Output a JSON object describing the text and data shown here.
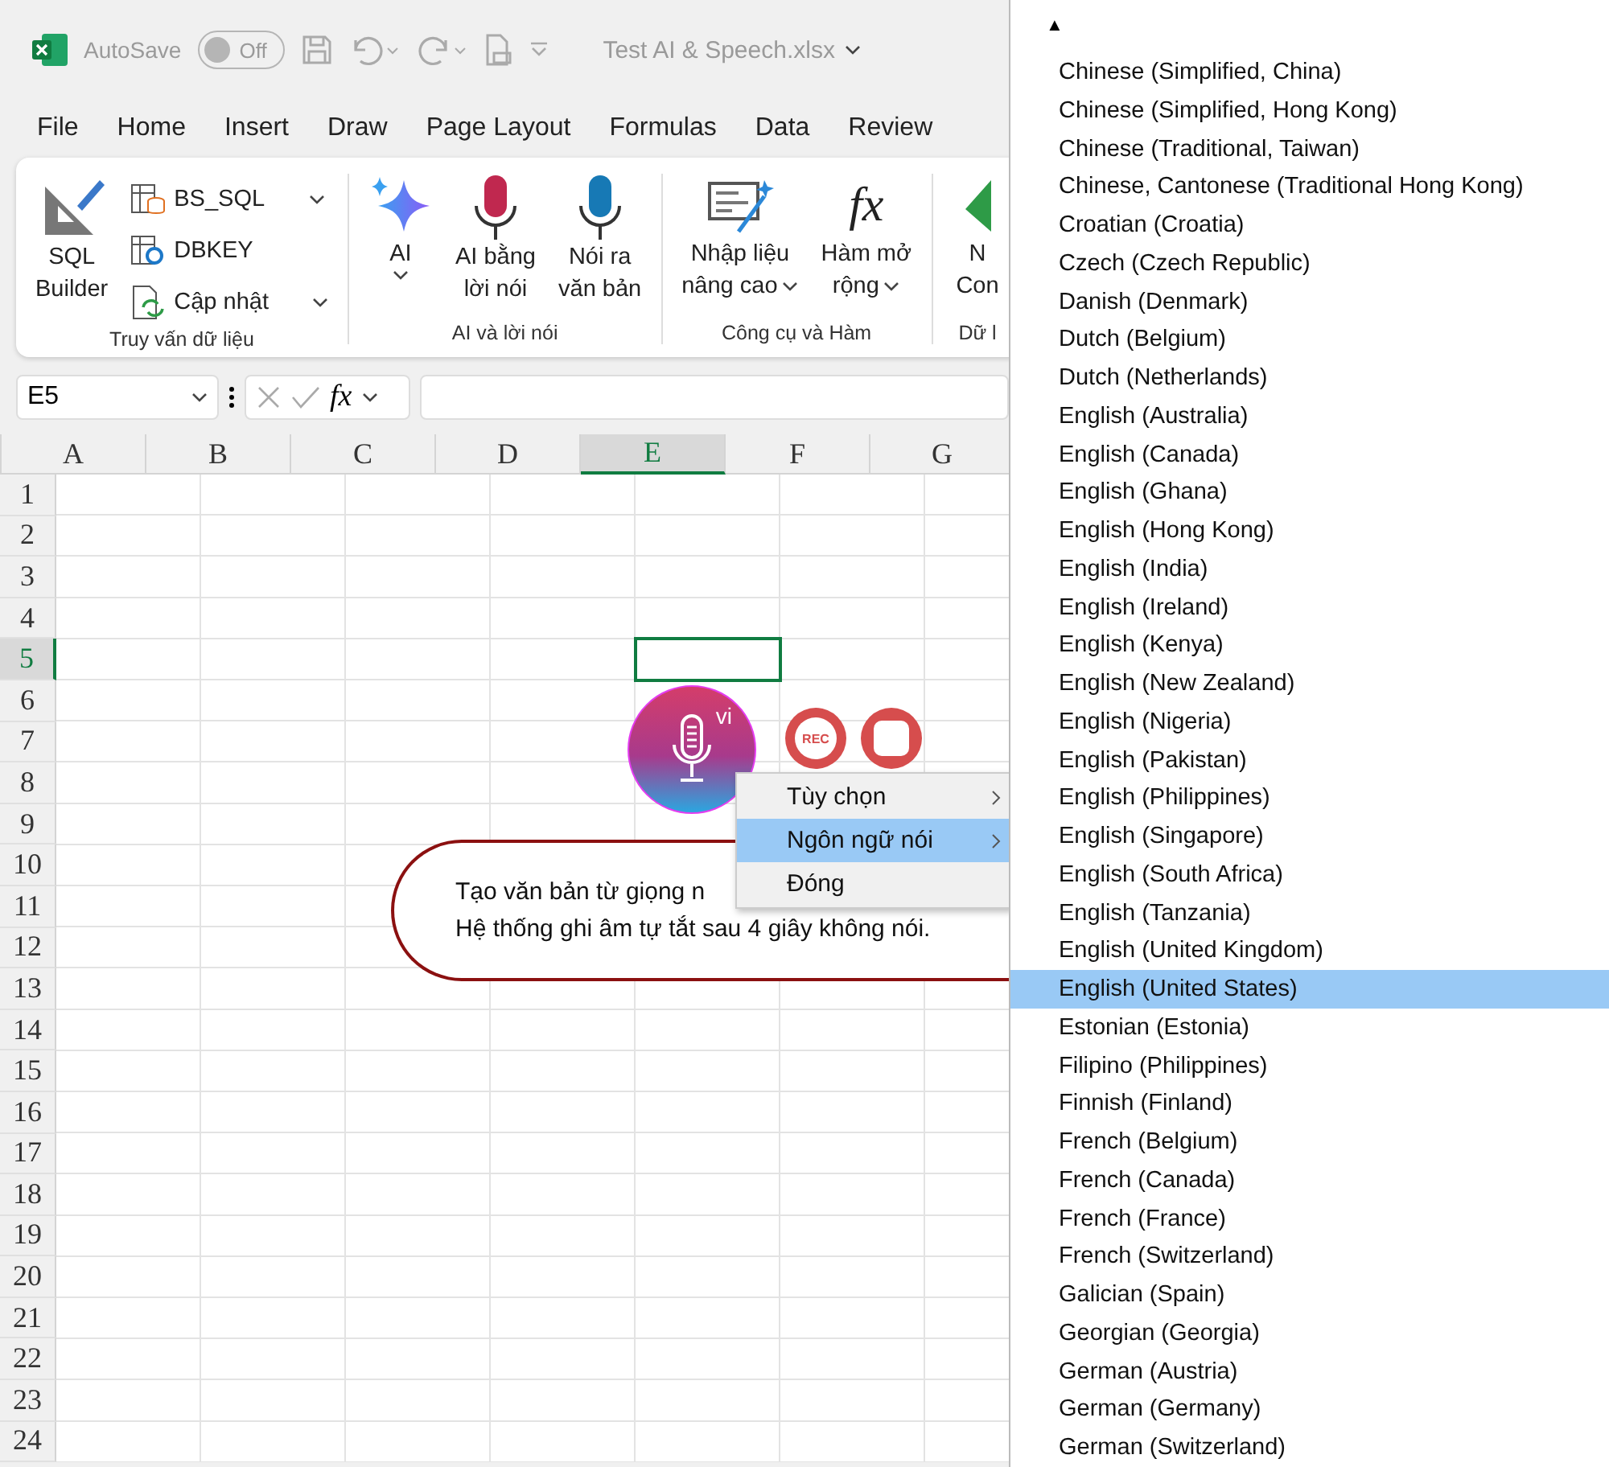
{
  "title_bar": {
    "autosave_label": "AutoSave",
    "autosave_toggle": {
      "label": "Off",
      "on": false
    },
    "file_title": "Test AI & Speech.xlsx"
  },
  "menu_tabs": [
    "File",
    "Home",
    "Insert",
    "Draw",
    "Page Layout",
    "Formulas",
    "Data",
    "Review"
  ],
  "ribbon": {
    "groups": [
      {
        "label": "Truy vấn dữ liệu",
        "large": [
          {
            "kind": "sql",
            "lines": [
              "SQL",
              "Builder"
            ],
            "caret": false
          }
        ],
        "small": [
          {
            "kind": "table-db",
            "label": "BS_SQL",
            "caret": true
          },
          {
            "kind": "table-gear",
            "label": "DBKEY",
            "caret": false
          },
          {
            "kind": "refresh",
            "label": "Cập nhật",
            "caret": true
          }
        ]
      },
      {
        "label": "AI và lời nói",
        "large": [
          {
            "kind": "sparkle",
            "lines": [
              "AI"
            ],
            "caret": true
          },
          {
            "kind": "mic-red",
            "lines": [
              "AI bằng",
              "lời nói"
            ],
            "caret": false
          },
          {
            "kind": "mic-blue",
            "lines": [
              "Nói ra",
              "văn bản"
            ],
            "caret": false
          }
        ]
      },
      {
        "label": "Công cụ và Hàm",
        "large": [
          {
            "kind": "form",
            "lines": [
              "Nhập liệu",
              "nâng cao"
            ],
            "caret": true
          },
          {
            "kind": "fx",
            "glyph": "fx",
            "lines": [
              "Hàm mở",
              "rộng"
            ],
            "caret": true
          }
        ]
      },
      {
        "label": "Dữ l",
        "large": [
          {
            "kind": "shape",
            "lines": [
              "N",
              "Con"
            ],
            "caret": false
          }
        ]
      }
    ]
  },
  "formula_bar": {
    "name_box": "E5",
    "fx": "fx"
  },
  "sheet": {
    "columns": [
      {
        "label": "A",
        "selected": false
      },
      {
        "label": "B",
        "selected": false
      },
      {
        "label": "C",
        "selected": false
      },
      {
        "label": "D",
        "selected": false
      },
      {
        "label": "E",
        "selected": true
      },
      {
        "label": "F",
        "selected": false
      },
      {
        "label": "G",
        "selected": false
      }
    ],
    "rows": [
      {
        "label": "1",
        "selected": false
      },
      {
        "label": "2",
        "selected": false
      },
      {
        "label": "3",
        "selected": false
      },
      {
        "label": "4",
        "selected": false
      },
      {
        "label": "5",
        "selected": true
      },
      {
        "label": "6",
        "selected": false
      },
      {
        "label": "7",
        "selected": false
      },
      {
        "label": "8",
        "selected": false
      },
      {
        "label": "9",
        "selected": false
      },
      {
        "label": "10",
        "selected": false
      },
      {
        "label": "11",
        "selected": false
      },
      {
        "label": "12",
        "selected": false
      },
      {
        "label": "13",
        "selected": false
      },
      {
        "label": "14",
        "selected": false
      },
      {
        "label": "15",
        "selected": false
      },
      {
        "label": "16",
        "selected": false
      },
      {
        "label": "17",
        "selected": false
      },
      {
        "label": "18",
        "selected": false
      },
      {
        "label": "19",
        "selected": false
      },
      {
        "label": "20",
        "selected": false
      },
      {
        "label": "21",
        "selected": false
      },
      {
        "label": "22",
        "selected": false
      },
      {
        "label": "23",
        "selected": false
      },
      {
        "label": "24",
        "selected": false
      }
    ]
  },
  "speech_widget": {
    "language_badge": "vi",
    "rec_label": "REC"
  },
  "callout": {
    "lines": [
      "Tạo văn bản từ giọng n",
      "Hệ thống ghi âm tự tắt sau 4 giây không nói."
    ]
  },
  "context_menu": [
    {
      "label": "Tùy chọn",
      "selected": false,
      "submenu": true
    },
    {
      "label": "Ngôn ngữ nói",
      "selected": true,
      "submenu": true
    },
    {
      "label": "Đóng",
      "selected": false,
      "submenu": false
    }
  ],
  "language_list": {
    "scroll_up": "▲",
    "items": [
      {
        "label": "Chinese (Simplified, China)",
        "selected": false
      },
      {
        "label": "Chinese (Simplified, Hong Kong)",
        "selected": false
      },
      {
        "label": "Chinese (Traditional, Taiwan)",
        "selected": false
      },
      {
        "label": "Chinese, Cantonese (Traditional Hong Kong)",
        "selected": false
      },
      {
        "label": "Croatian (Croatia)",
        "selected": false
      },
      {
        "label": "Czech (Czech Republic)",
        "selected": false
      },
      {
        "label": "Danish (Denmark)",
        "selected": false
      },
      {
        "label": "Dutch (Belgium)",
        "selected": false
      },
      {
        "label": "Dutch (Netherlands)",
        "selected": false
      },
      {
        "label": "English (Australia)",
        "selected": false
      },
      {
        "label": "English (Canada)",
        "selected": false
      },
      {
        "label": "English (Ghana)",
        "selected": false
      },
      {
        "label": "English (Hong Kong)",
        "selected": false
      },
      {
        "label": "English (India)",
        "selected": false
      },
      {
        "label": "English (Ireland)",
        "selected": false
      },
      {
        "label": "English (Kenya)",
        "selected": false
      },
      {
        "label": "English (New Zealand)",
        "selected": false
      },
      {
        "label": "English (Nigeria)",
        "selected": false
      },
      {
        "label": "English (Pakistan)",
        "selected": false
      },
      {
        "label": "English (Philippines)",
        "selected": false
      },
      {
        "label": "English (Singapore)",
        "selected": false
      },
      {
        "label": "English (South Africa)",
        "selected": false
      },
      {
        "label": "English (Tanzania)",
        "selected": false
      },
      {
        "label": "English (United Kingdom)",
        "selected": false
      },
      {
        "label": "English (United States)",
        "selected": true
      },
      {
        "label": "Estonian (Estonia)",
        "selected": false
      },
      {
        "label": "Filipino (Philippines)",
        "selected": false
      },
      {
        "label": "Finnish (Finland)",
        "selected": false
      },
      {
        "label": "French (Belgium)",
        "selected": false
      },
      {
        "label": "French (Canada)",
        "selected": false
      },
      {
        "label": "French (France)",
        "selected": false
      },
      {
        "label": "French (Switzerland)",
        "selected": false
      },
      {
        "label": "Galician (Spain)",
        "selected": false
      },
      {
        "label": "Georgian (Georgia)",
        "selected": false
      },
      {
        "label": "German (Austria)",
        "selected": false
      },
      {
        "label": "German (Germany)",
        "selected": false
      },
      {
        "label": "German (Switzerland)",
        "selected": false
      }
    ]
  }
}
